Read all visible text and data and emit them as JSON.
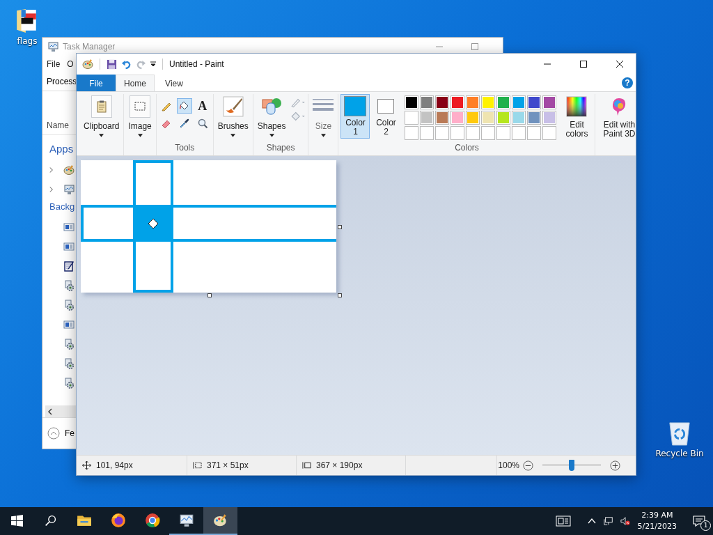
{
  "desktop_icons": [
    {
      "kind": "folder",
      "label": "flags"
    },
    {
      "kind": "recycle",
      "label": "Recycle Bin"
    }
  ],
  "task_manager": {
    "title": "Task Manager",
    "menu": [
      "File",
      "O"
    ],
    "tab": "Process",
    "column": "Name",
    "groups": [
      {
        "label": "Apps",
        "rows": [
          {
            "kind": "paint",
            "expandable": true
          },
          {
            "kind": "monitor",
            "expandable": true
          }
        ]
      },
      {
        "label": "Backg",
        "rows": [
          {
            "kind": "window",
            "expandable": false
          },
          {
            "kind": "window",
            "expandable": false
          },
          {
            "kind": "notepad",
            "expandable": false
          },
          {
            "kind": "gear",
            "expandable": false
          },
          {
            "kind": "gear",
            "expandable": false
          },
          {
            "kind": "window",
            "expandable": false
          },
          {
            "kind": "gear",
            "expandable": false
          },
          {
            "kind": "gear",
            "expandable": false
          },
          {
            "kind": "gear",
            "expandable": false
          }
        ]
      }
    ],
    "footer": "Fe"
  },
  "paint": {
    "title": "Untitled - Paint",
    "help": "?",
    "tabs": [
      {
        "label": "File",
        "kind": "file",
        "selected": false
      },
      {
        "label": "Home",
        "kind": "tab",
        "selected": true
      },
      {
        "label": "View",
        "kind": "tab",
        "selected": false
      }
    ],
    "clipboard": "Clipboard",
    "image": "Image",
    "tools": [
      {
        "kind": "pencil",
        "selected": false
      },
      {
        "kind": "fill",
        "selected": true
      },
      {
        "kind": "text",
        "glyph": "A",
        "selected": false
      },
      {
        "kind": "eraser",
        "selected": false
      },
      {
        "kind": "picker",
        "selected": false
      },
      {
        "kind": "magnifier",
        "selected": false
      }
    ],
    "tools_label": "Tools",
    "brushes": "Brushes",
    "shapes": "Shapes",
    "shape_options": [
      {
        "kind": "outline",
        "disabled": true
      },
      {
        "kind": "fill",
        "disabled": true
      }
    ],
    "shapes_label": "Shapes",
    "size": {
      "label": "Size",
      "disabled": true
    },
    "active_colors": [
      {
        "label": "Color 1",
        "color": "#00a2e8",
        "selected": true
      },
      {
        "label": "Color 2",
        "color": "#ffffff",
        "selected": false
      }
    ],
    "palette": [
      {
        "color": "#000000"
      },
      {
        "color": "#7f7f7f"
      },
      {
        "color": "#880015"
      },
      {
        "color": "#ed1c24"
      },
      {
        "color": "#ff7f27"
      },
      {
        "color": "#fff200"
      },
      {
        "color": "#22b14c"
      },
      {
        "color": "#00a2e8"
      },
      {
        "color": "#3f48cc"
      },
      {
        "color": "#a349a4"
      },
      {
        "color": "#ffffff"
      },
      {
        "color": "#c3c3c3"
      },
      {
        "color": "#b97a57"
      },
      {
        "color": "#ffaec9"
      },
      {
        "color": "#ffc90e"
      },
      {
        "color": "#efe4b0"
      },
      {
        "color": "#b5e61d"
      },
      {
        "color": "#99d9ea"
      },
      {
        "color": "#7092be"
      },
      {
        "color": "#c8bfe7"
      }
    ],
    "edit_colors": "Edit colors",
    "colors_label": "Colors",
    "paint3d": "Edit with Paint 3D",
    "status": [
      {
        "kind": "cursor",
        "text": "101, 94px"
      },
      {
        "kind": "selection",
        "text": "371 × 51px"
      },
      {
        "kind": "size",
        "text": "367 × 190px"
      }
    ],
    "zoom": {
      "text": "100%",
      "level": 0.5
    }
  },
  "taskbar": {
    "apps": [
      {
        "kind": "start",
        "open": false,
        "selected": false
      },
      {
        "kind": "search",
        "open": false,
        "selected": false
      },
      {
        "kind": "explorer",
        "open": false,
        "selected": false
      },
      {
        "kind": "firefox",
        "open": false,
        "selected": false
      },
      {
        "kind": "chrome",
        "open": false,
        "selected": false
      },
      {
        "kind": "taskmanager",
        "open": true,
        "selected": false
      },
      {
        "kind": "paint",
        "open": true,
        "selected": true
      }
    ],
    "tray": [
      {
        "kind": "news"
      },
      {
        "kind": "chevron"
      },
      {
        "kind": "network"
      },
      {
        "kind": "volume-muted"
      }
    ],
    "time": "2:39 AM",
    "date": "5/21/2023",
    "notifications": "1"
  }
}
